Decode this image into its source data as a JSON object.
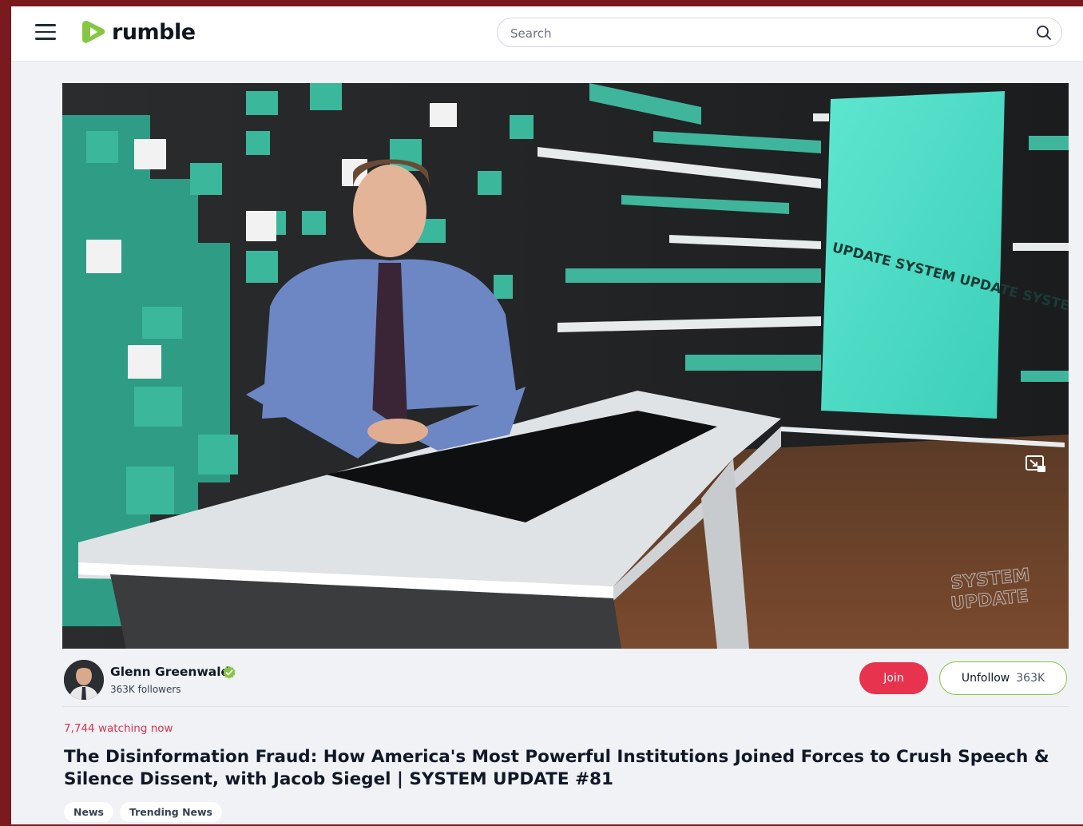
{
  "header": {
    "logo_text": "rumble",
    "search_placeholder": "Search",
    "brand_color": "#85c742"
  },
  "video": {
    "screen_text": "UPDATE SYSTEM UPDATE SYSTEM",
    "watermark_line1": "SYSTEM",
    "watermark_line2": "UPDATE"
  },
  "channel": {
    "name": "Glenn Greenwald",
    "followers": "363K followers",
    "join_label": "Join",
    "unfollow_label": "Unfollow",
    "unfollow_count": "363K"
  },
  "stats": {
    "watching": "7,744 watching now"
  },
  "title": "The Disinformation Fraud: How America's Most Powerful Institutions Joined Forces to Crush Speech & Silence Dissent, with Jacob Siegel | SYSTEM UPDATE #81",
  "tags": [
    {
      "label": "News"
    },
    {
      "label": "Trending News"
    }
  ]
}
